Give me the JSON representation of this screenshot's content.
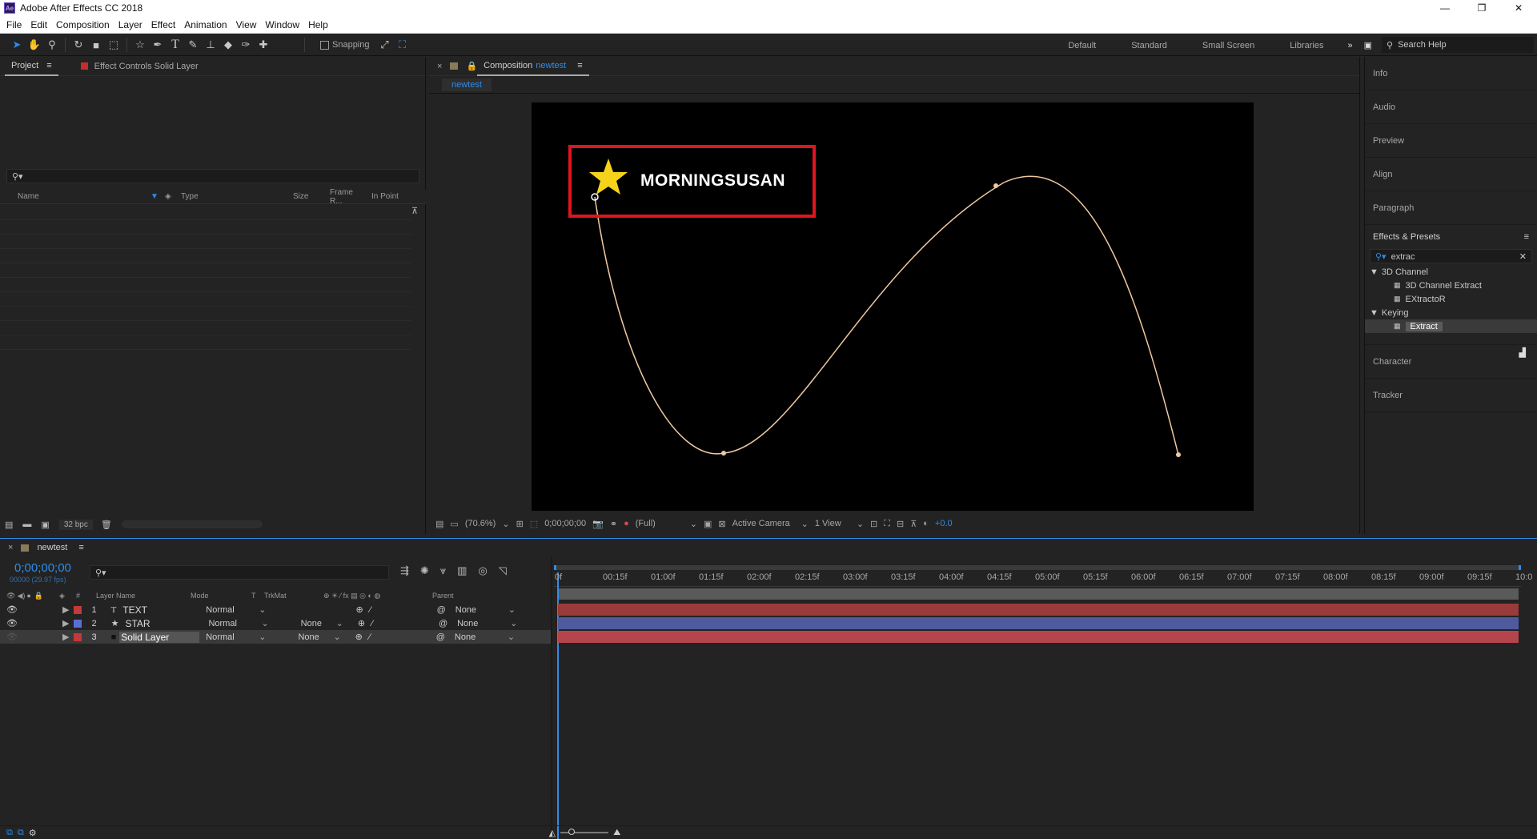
{
  "window": {
    "title": "Adobe After Effects CC 2018",
    "logo_text": "Ae",
    "controls": [
      "—",
      "❐",
      "✕"
    ]
  },
  "menu": [
    "File",
    "Edit",
    "Composition",
    "Layer",
    "Effect",
    "Animation",
    "View",
    "Window",
    "Help"
  ],
  "toolbar": {
    "snapping_label": "Snapping",
    "workspaces": [
      "Default",
      "Standard",
      "Small Screen",
      "Libraries"
    ],
    "overflow": "»",
    "search_help_placeholder": "Search Help"
  },
  "project_panel": {
    "tab_project": "Project",
    "tab_effect_controls": "Effect Controls Solid Layer",
    "columns": [
      "Name",
      "Type",
      "Size",
      "Frame R...",
      "In Point"
    ],
    "bpc": "32 bpc"
  },
  "composition_panel": {
    "tab_prefix": "Composition",
    "comp_name": "newtest",
    "subtab": "newtest",
    "overlay_text": "MORNINGSUSAN",
    "zoom": "(70.6%)",
    "timecode": "0;00;00;00",
    "resolution": "(Full)",
    "camera": "Active Camera",
    "views": "1 View",
    "exposure": "+0.0"
  },
  "right_panel": {
    "items_top": [
      "Info",
      "Audio",
      "Preview",
      "Align",
      "Paragraph"
    ],
    "effects_title": "Effects & Presets",
    "search_value": "extrac",
    "tree": [
      {
        "label": "3D Channel",
        "type": "folder"
      },
      {
        "label": "3D Channel Extract",
        "type": "effect"
      },
      {
        "label": "EXtractoR",
        "type": "effect"
      },
      {
        "label": "Keying",
        "type": "folder"
      },
      {
        "label": "Extract",
        "type": "effect",
        "selected": true
      }
    ],
    "items_bottom": [
      "Character",
      "Tracker"
    ]
  },
  "timeline": {
    "tab": "newtest",
    "timecode": "0;00;00;00",
    "fps": "00000 (29.97 fps)",
    "columns": {
      "num": "#",
      "layer_name": "Layer Name",
      "mode": "Mode",
      "t": "T",
      "trkmat": "TrkMat",
      "parent": "Parent"
    },
    "layers": [
      {
        "num": "1",
        "type_icon": "T",
        "name": "TEXT",
        "mode": "Normal",
        "trkmat": "",
        "parent": "None",
        "label_color": "#c23a3a"
      },
      {
        "num": "2",
        "type_icon": "★",
        "name": "STAR",
        "mode": "Normal",
        "trkmat": "None",
        "parent": "None",
        "label_color": "#5a6fd6"
      },
      {
        "num": "3",
        "type_icon": "■",
        "name": "Solid Layer",
        "mode": "Normal",
        "trkmat": "None",
        "parent": "None",
        "label_color": "#c23a3a"
      }
    ],
    "ruler": [
      "0f",
      "00:15f",
      "01:00f",
      "01:15f",
      "02:00f",
      "02:15f",
      "03:00f",
      "03:15f",
      "04:00f",
      "04:15f",
      "05:00f",
      "05:15f",
      "06:00f",
      "06:15f",
      "07:00f",
      "07:15f",
      "08:00f",
      "08:15f",
      "09:00f",
      "09:15f",
      "10:0"
    ],
    "bar_colors": [
      "#9a3b3b",
      "#4f5a9e",
      "#b5454d"
    ]
  },
  "colors": {
    "accent": "#2d8ceb",
    "highlight_box": "#e0141e",
    "star": "#f5d31b",
    "path": "#f0c8a0"
  }
}
